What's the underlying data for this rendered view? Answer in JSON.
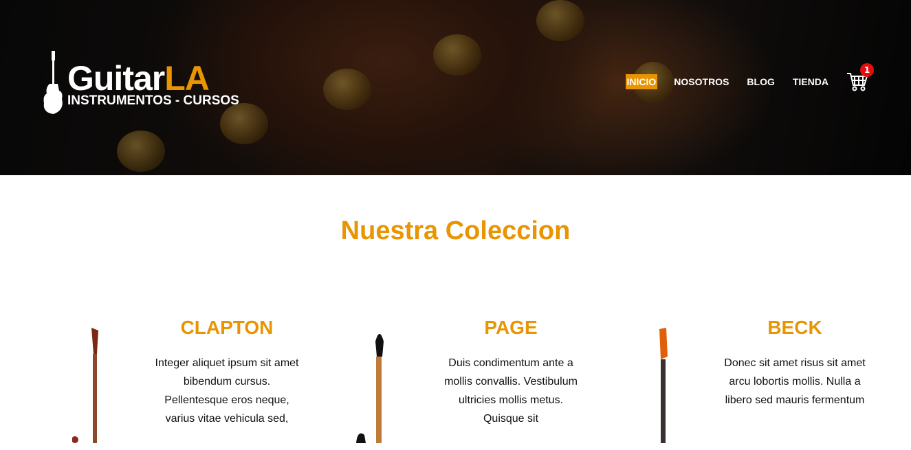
{
  "header": {
    "logo": {
      "brand": "Guitar",
      "brand_accent": "LA",
      "tagline": "INSTRUMENTOS - CURSOS"
    },
    "nav": [
      {
        "label": "INICIO",
        "active": true
      },
      {
        "label": "NOSOTROS"
      },
      {
        "label": "BLOG"
      },
      {
        "label": "TIENDA"
      }
    ],
    "cart": {
      "icon": "cart-icon",
      "count": "1"
    }
  },
  "main": {
    "title": "Nuestra Coleccion",
    "products": [
      {
        "name": "CLAPTON",
        "description": "Integer aliquet ipsum sit amet bibendum cursus. Pellentesque eros neque, varius vitae vehicula sed,",
        "body_color": "#8a2a1a"
      },
      {
        "name": "PAGE",
        "description": "Duis condimentum ante a mollis convallis. Vestibulum ultricies mollis metus. Quisque sit",
        "body_color": "#111111"
      },
      {
        "name": "BECK",
        "description": "Donec sit amet risus sit amet arcu lobortis mollis. Nulla a libero sed mauris fermentum",
        "body_color": "#e0600a"
      }
    ]
  },
  "colors": {
    "accent": "#e99401",
    "badge": "#e01010"
  }
}
